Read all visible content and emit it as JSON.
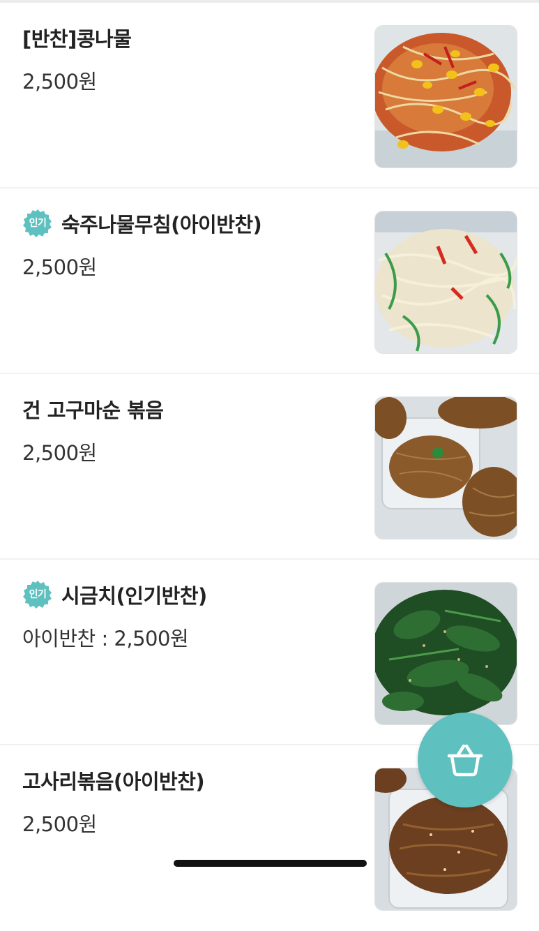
{
  "menu_items": [
    {
      "title": "[반찬]콩나물",
      "price": "2,500원",
      "popular": false,
      "thumbnail_icon": "bean-sprouts-photo"
    },
    {
      "title": "숙주나물무침(아이반찬)",
      "price": "2,500원",
      "popular": true,
      "badge": "인기",
      "thumbnail_icon": "mung-bean-sprouts-photo"
    },
    {
      "title": "건 고구마순 볶음",
      "price": "2,500원",
      "popular": false,
      "thumbnail_icon": "sweet-potato-stems-photo"
    },
    {
      "title": "시금치(인기반찬)",
      "price": "아이반찬 : 2,500원",
      "popular": true,
      "badge": "인기",
      "thumbnail_icon": "spinach-photo"
    },
    {
      "title": "고사리볶음(아이반찬)",
      "price": "2,500원",
      "popular": false,
      "thumbnail_icon": "bracken-photo"
    }
  ],
  "cart_button": {
    "icon": "basket-icon",
    "color": "#5fc0c0"
  },
  "colors": {
    "accent": "#5fc0c0",
    "text": "#222222"
  }
}
